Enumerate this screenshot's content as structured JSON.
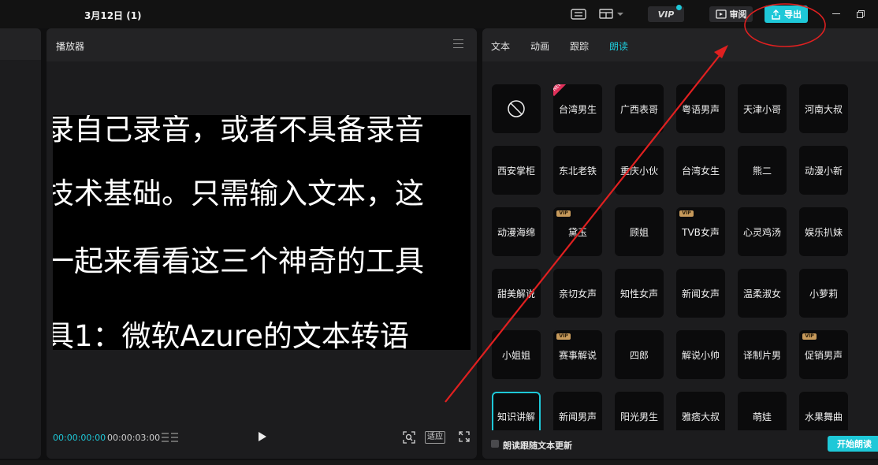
{
  "window": {
    "title": "3月12日 (1)",
    "vip_label": "VIP",
    "review_label": "审阅",
    "export_label": "导出"
  },
  "player": {
    "title": "播放器",
    "subtitle_lines": [
      "录自己录音，或者不具备录音",
      "技术基础。只需输入文本，这",
      "一起来看看这三个神奇的工具",
      "具1：微软Azure的文本转语"
    ],
    "time_current": "00:00:00:00",
    "time_total": "00:00:03:00",
    "fit_label": "适应"
  },
  "right_panel": {
    "tabs": [
      {
        "label": "文本",
        "active": false
      },
      {
        "label": "动画",
        "active": false
      },
      {
        "label": "跟踪",
        "active": false
      },
      {
        "label": "朗读",
        "active": true
      }
    ],
    "voices": [
      {
        "label": "",
        "none": true
      },
      {
        "label": "台湾男生",
        "new": true
      },
      {
        "label": "广西表哥"
      },
      {
        "label": "粤语男声"
      },
      {
        "label": "天津小哥"
      },
      {
        "label": "河南大叔"
      },
      {
        "label": "西安掌柜"
      },
      {
        "label": "东北老铁"
      },
      {
        "label": "重庆小伙"
      },
      {
        "label": "台湾女生"
      },
      {
        "label": "熊二"
      },
      {
        "label": "动漫小新"
      },
      {
        "label": "动漫海绵"
      },
      {
        "label": "黛玉",
        "vip": true
      },
      {
        "label": "顾姐"
      },
      {
        "label": "TVB女声",
        "vip": true
      },
      {
        "label": "心灵鸡汤"
      },
      {
        "label": "娱乐扒妹"
      },
      {
        "label": "甜美解说"
      },
      {
        "label": "亲切女声"
      },
      {
        "label": "知性女声"
      },
      {
        "label": "新闻女声"
      },
      {
        "label": "温柔淑女"
      },
      {
        "label": "小萝莉"
      },
      {
        "label": "小姐姐"
      },
      {
        "label": "赛事解说",
        "vip": true
      },
      {
        "label": "四郎"
      },
      {
        "label": "解说小帅"
      },
      {
        "label": "译制片男"
      },
      {
        "label": "促销男声",
        "vip": true
      },
      {
        "label": "知识讲解",
        "selected": true
      },
      {
        "label": "新闻男声"
      },
      {
        "label": "阳光男生"
      },
      {
        "label": "雅痞大叔"
      },
      {
        "label": "萌娃"
      },
      {
        "label": "水果舞曲"
      }
    ],
    "vip_tag": "VIP",
    "new_tag": "NEW",
    "follow_text_label": "朗读跟随文本更新",
    "start_button_label": "开始朗读"
  },
  "colors": {
    "accent": "#1ec8d8",
    "annotation": "#e02020"
  }
}
